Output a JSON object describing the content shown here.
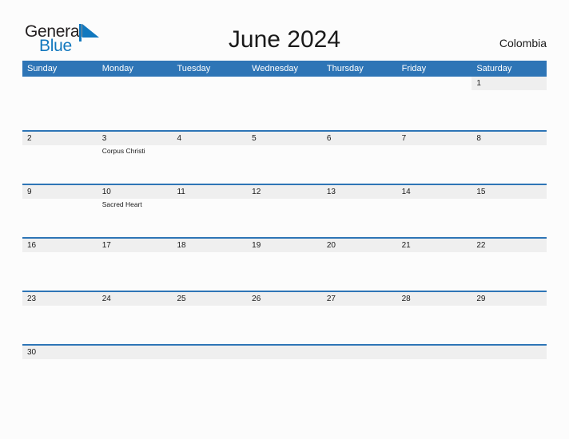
{
  "brand": {
    "name_part1": "General",
    "name_part2": "Blue",
    "flag_icon": "blue-flag-triangle-icon",
    "color_dark": "#231f20",
    "color_blue": "#1278be"
  },
  "header": {
    "title": "June 2024",
    "region": "Colombia"
  },
  "theme": {
    "header_blue": "#2e75b6",
    "band_gray": "#efefef",
    "page_background": "#fcfcfc",
    "text_dark": "#1a1a1a"
  },
  "calendar": {
    "weekday_headers": [
      "Sunday",
      "Monday",
      "Tuesday",
      "Wednesday",
      "Thursday",
      "Friday",
      "Saturday"
    ],
    "weeks": [
      {
        "size": "tall",
        "days": [
          {
            "number": "",
            "event": "",
            "blank": true
          },
          {
            "number": "",
            "event": "",
            "blank": true
          },
          {
            "number": "",
            "event": "",
            "blank": true
          },
          {
            "number": "",
            "event": "",
            "blank": true
          },
          {
            "number": "",
            "event": "",
            "blank": true
          },
          {
            "number": "",
            "event": "",
            "blank": true
          },
          {
            "number": "1",
            "event": "",
            "blank": false
          }
        ]
      },
      {
        "size": "tall",
        "days": [
          {
            "number": "2",
            "event": "",
            "blank": false
          },
          {
            "number": "3",
            "event": "Corpus Christi",
            "blank": false
          },
          {
            "number": "4",
            "event": "",
            "blank": false
          },
          {
            "number": "5",
            "event": "",
            "blank": false
          },
          {
            "number": "6",
            "event": "",
            "blank": false
          },
          {
            "number": "7",
            "event": "",
            "blank": false
          },
          {
            "number": "8",
            "event": "",
            "blank": false
          }
        ]
      },
      {
        "size": "tall",
        "days": [
          {
            "number": "9",
            "event": "",
            "blank": false
          },
          {
            "number": "10",
            "event": "Sacred Heart",
            "blank": false
          },
          {
            "number": "11",
            "event": "",
            "blank": false
          },
          {
            "number": "12",
            "event": "",
            "blank": false
          },
          {
            "number": "13",
            "event": "",
            "blank": false
          },
          {
            "number": "14",
            "event": "",
            "blank": false
          },
          {
            "number": "15",
            "event": "",
            "blank": false
          }
        ]
      },
      {
        "size": "tall",
        "days": [
          {
            "number": "16",
            "event": "",
            "blank": false
          },
          {
            "number": "17",
            "event": "",
            "blank": false
          },
          {
            "number": "18",
            "event": "",
            "blank": false
          },
          {
            "number": "19",
            "event": "",
            "blank": false
          },
          {
            "number": "20",
            "event": "",
            "blank": false
          },
          {
            "number": "21",
            "event": "",
            "blank": false
          },
          {
            "number": "22",
            "event": "",
            "blank": false
          }
        ]
      },
      {
        "size": "tall",
        "days": [
          {
            "number": "23",
            "event": "",
            "blank": false
          },
          {
            "number": "24",
            "event": "",
            "blank": false
          },
          {
            "number": "25",
            "event": "",
            "blank": false
          },
          {
            "number": "26",
            "event": "",
            "blank": false
          },
          {
            "number": "27",
            "event": "",
            "blank": false
          },
          {
            "number": "28",
            "event": "",
            "blank": false
          },
          {
            "number": "29",
            "event": "",
            "blank": false
          }
        ]
      },
      {
        "size": "short",
        "days": [
          {
            "number": "30",
            "event": "",
            "blank": false
          },
          {
            "number": "",
            "event": "",
            "blank": false
          },
          {
            "number": "",
            "event": "",
            "blank": false
          },
          {
            "number": "",
            "event": "",
            "blank": false
          },
          {
            "number": "",
            "event": "",
            "blank": false
          },
          {
            "number": "",
            "event": "",
            "blank": false
          },
          {
            "number": "",
            "event": "",
            "blank": false
          }
        ]
      }
    ]
  }
}
